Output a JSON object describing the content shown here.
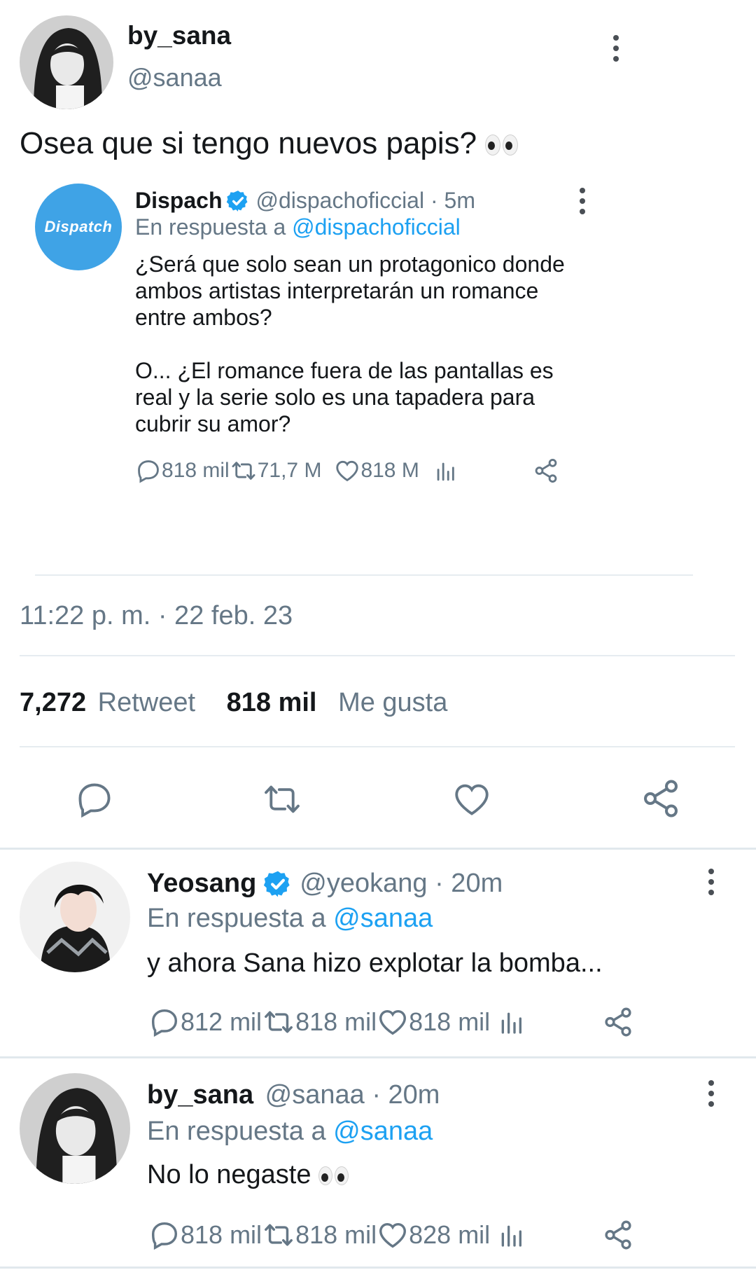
{
  "main_tweet": {
    "display_name": "by_sana",
    "handle": "@sanaa",
    "text": "Osea que si tengo nuevos papis?",
    "emoji": "👀",
    "timestamp": "11:22 p. m. · 22 feb. 23",
    "stats": {
      "retweets_count": "7,272",
      "retweets_label": "Retweet",
      "likes_count": "818 mil",
      "likes_label": "Me gusta"
    }
  },
  "quoted_tweet": {
    "logo_text": "Dispatch",
    "display_name": "Dispach",
    "handle_time": "@dispachoficcial · 5m",
    "reply_prefix": "En respuesta a",
    "reply_to": "@dispachoficcial",
    "paragraph1": "¿Será que solo sean un protagonico donde ambos artistas interpretarán un romance entre ambos?",
    "paragraph2": "O... ¿El romance fuera de las pantallas es real y la serie solo es una tapadera para cubrir su amor?",
    "replies": "818 mil",
    "retweets": "71,7 M",
    "likes": "818 M"
  },
  "replies": [
    {
      "display_name": "Yeosang",
      "verified": true,
      "handle_time": "@yeokang · 20m",
      "reply_prefix": "En respuesta a",
      "reply_to": "@sanaa",
      "text": "y ahora Sana hizo explotar la bomba...",
      "replies": "812 mil",
      "retweets": "818 mil",
      "likes": "818 mil"
    },
    {
      "display_name": "by_sana",
      "verified": false,
      "handle_time": "@sanaa · 20m",
      "reply_prefix": "En respuesta a",
      "reply_to": "@sanaa",
      "text": "No lo negaste",
      "emoji": "👀",
      "replies": "818 mil",
      "retweets": "818 mil",
      "likes": "828 mil"
    }
  ],
  "colors": {
    "accent": "#1da1f2",
    "text": "#14171a",
    "secondary": "#657786",
    "divider": "#e6ecf0"
  },
  "icons": [
    "more-vertical-icon",
    "verified-badge-icon",
    "reply-icon",
    "retweet-icon",
    "like-icon",
    "analytics-icon",
    "share-icon"
  ]
}
